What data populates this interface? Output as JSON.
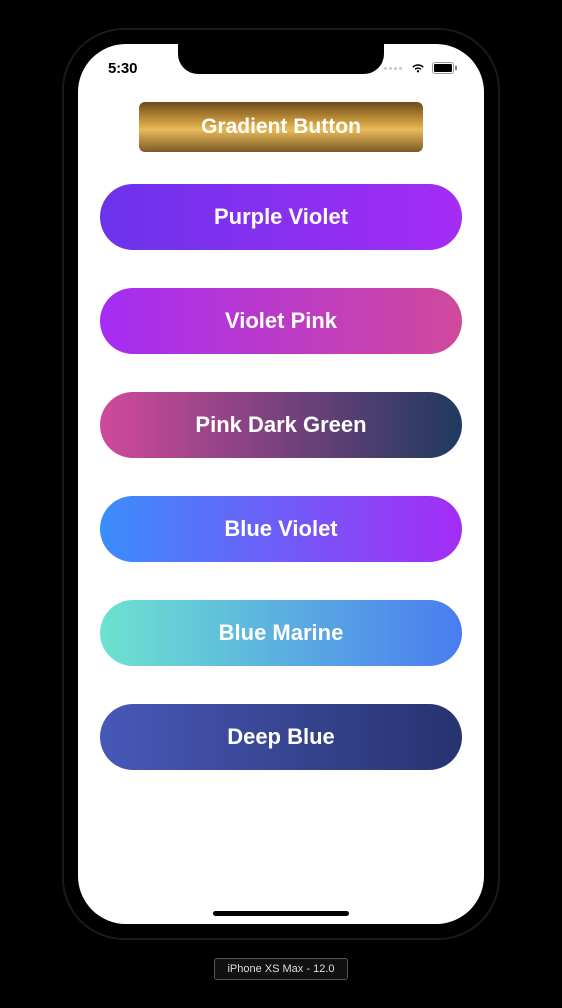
{
  "status_bar": {
    "time": "5:30"
  },
  "title_button": {
    "label": "Gradient Button",
    "gradient": "gold-brown"
  },
  "buttons": [
    {
      "label": "Purple Violet",
      "gradient": "purple-violet",
      "colors": [
        "#6b33ea",
        "#a52cf5"
      ]
    },
    {
      "label": "Violet Pink",
      "gradient": "violet-pink",
      "colors": [
        "#a52cf5",
        "#d1499b"
      ]
    },
    {
      "label": "Pink Dark Green",
      "gradient": "pink-darkgreen",
      "colors": [
        "#d1499b",
        "#1f3a5f"
      ]
    },
    {
      "label": "Blue Violet",
      "gradient": "blue-violet",
      "colors": [
        "#3a8dfc",
        "#a52cf5"
      ]
    },
    {
      "label": "Blue Marine",
      "gradient": "blue-marine",
      "colors": [
        "#6de3cf",
        "#4a7cf0"
      ]
    },
    {
      "label": "Deep Blue",
      "gradient": "deep-blue",
      "colors": [
        "#4858b8",
        "#27336f"
      ]
    }
  ],
  "device_label": "iPhone XS Max - 12.0"
}
